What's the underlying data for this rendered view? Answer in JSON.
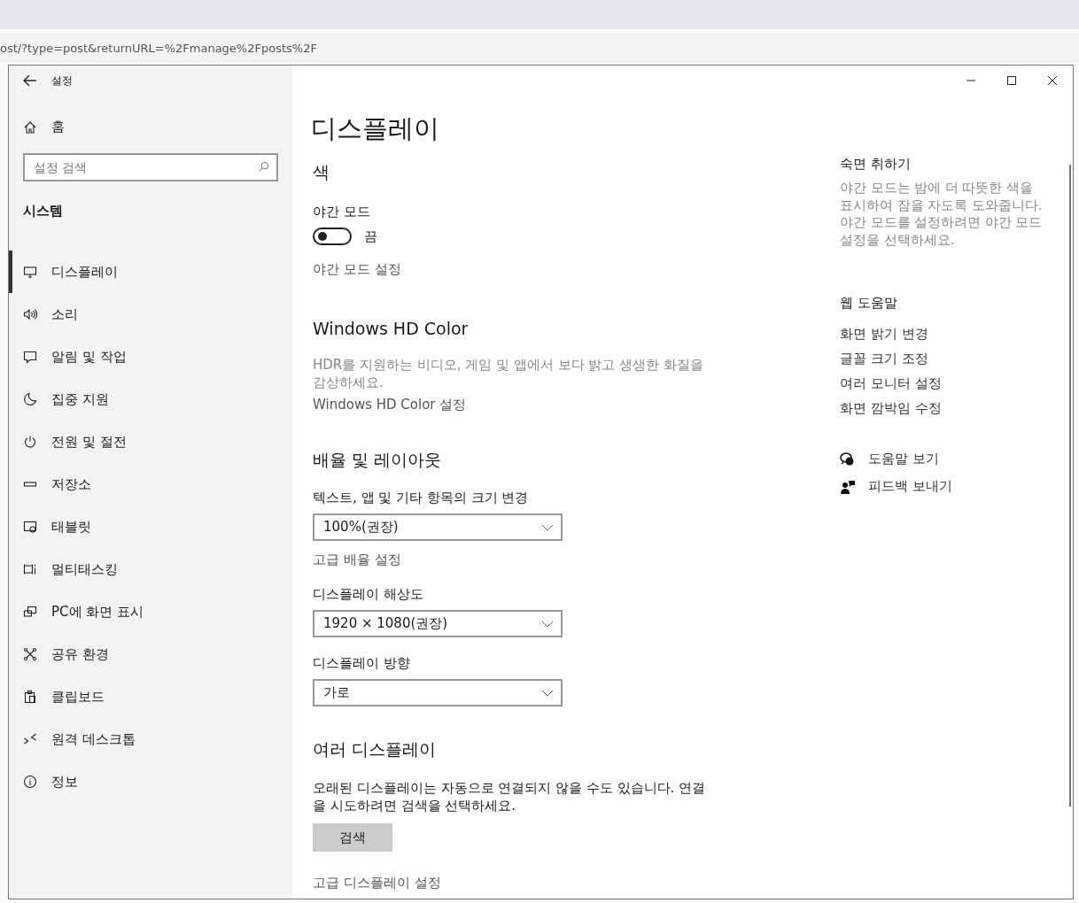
{
  "browser": {
    "url": "ost/?type=post&returnURL=%2Fmanage%2Fposts%2F"
  },
  "window": {
    "title": "설정"
  },
  "sidebar": {
    "home": "홈",
    "search": {
      "placeholder": "설정 검색"
    },
    "section": "시스템",
    "items": [
      {
        "label": "디스플레이",
        "selected": true
      },
      {
        "label": "소리",
        "selected": false
      },
      {
        "label": "알림 및 작업",
        "selected": false
      },
      {
        "label": "집중 지원",
        "selected": false
      },
      {
        "label": "전원 및 절전",
        "selected": false
      },
      {
        "label": "저장소",
        "selected": false
      },
      {
        "label": "태블릿",
        "selected": false
      },
      {
        "label": "멀티태스킹",
        "selected": false
      },
      {
        "label": "PC에 화면 표시",
        "selected": false
      },
      {
        "label": "공유 환경",
        "selected": false
      },
      {
        "label": "클립보드",
        "selected": false
      },
      {
        "label": "원격 데스크톱",
        "selected": false
      },
      {
        "label": "정보",
        "selected": false
      }
    ]
  },
  "page": {
    "title": "디스플레이",
    "color": {
      "heading": "색",
      "night_mode": {
        "label": "야간 모드",
        "on": false,
        "state_text": "끔"
      },
      "link": "야간 모드 설정"
    },
    "hd_color": {
      "heading": "Windows HD Color",
      "description": "HDR를 지원하는 비디오, 게임 및 앱에서 보다 밝고 생생한 화질을 감상하세요.",
      "link": "Windows HD Color 설정"
    },
    "scale_layout": {
      "heading": "배율 및 레이아웃",
      "dropdowns": [
        {
          "label": "텍스트, 앱 및 기타 항목의 크기 변경",
          "value": "100%(권장)",
          "link": "고급 배율 설정"
        },
        {
          "label": "디스플레이 해상도",
          "value": "1920 × 1080(권장)"
        },
        {
          "label": "디스플레이 방향",
          "value": "가로"
        }
      ]
    },
    "multi_display": {
      "heading": "여러 디스플레이",
      "description": "오래된 디스플레이는 자동으로 연결되지 않을 수도 있습니다. 연결을 시도하려면 검색을 선택하세요.",
      "button": "검색",
      "link": "고급 디스플레이 설정"
    }
  },
  "aside": {
    "sleep": {
      "heading": "숙면 취하기",
      "text": "야간 모드는 밤에 더 따뜻한 색을 표시하여 잠을 자도록 도와줍니다. 야간 모드를 설정하려면 야간 모드 설정을 선택하세요."
    },
    "web_help": {
      "heading": "웹 도움말",
      "links": [
        "화면 밝기 변경",
        "글꼴 크기 조정",
        "여러 모니터 설정",
        "화면 깜박임 수정"
      ]
    },
    "actions": [
      {
        "kind": "help",
        "label": "도움말 보기"
      },
      {
        "kind": "feedback",
        "label": "피드백 보내기"
      }
    ]
  }
}
